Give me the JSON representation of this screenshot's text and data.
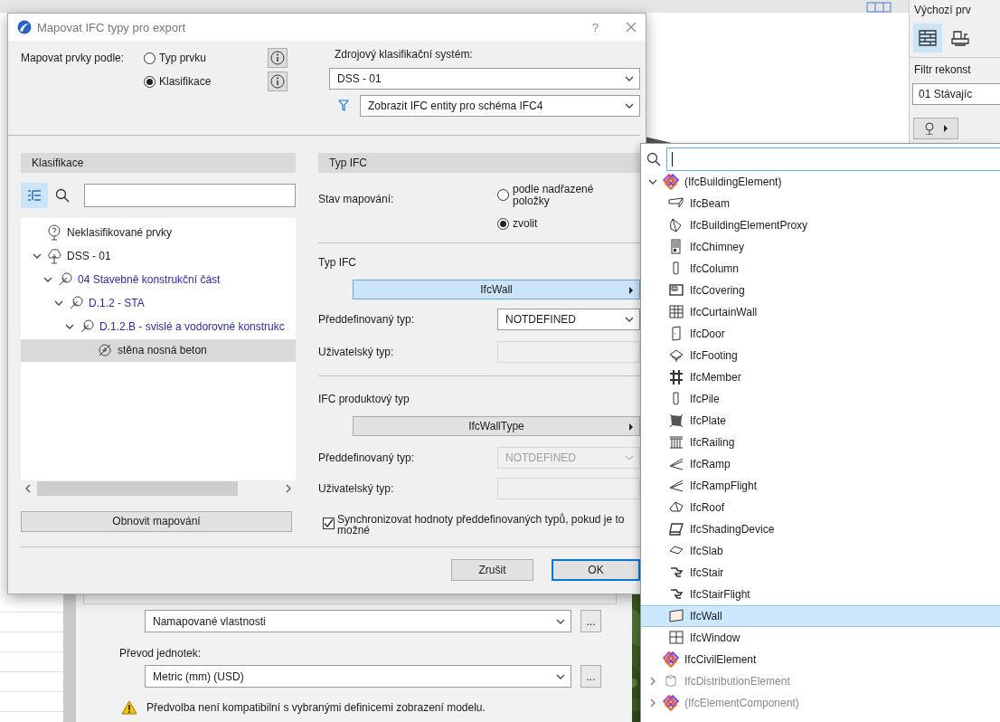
{
  "background": {
    "panel_title": "Výchozí prv",
    "filter_label": "Filtr rekonst",
    "filter_value": "01 Stávajíc",
    "back_dialog": {
      "property_value": "Namapované vlastnosti",
      "units_label": "Převod jednotek:",
      "units_value": "Metric (mm) (USD)",
      "more_button": "...",
      "warning": "Předvolba není kompatibilní s vybranými definicemi zobrazení modelu."
    }
  },
  "dialog": {
    "title": "Mapovat IFC typy pro export",
    "help": "?",
    "map_by_label": "Mapovat prvky podle:",
    "map_by_options": [
      {
        "label": "Typ prvku",
        "selected": false
      },
      {
        "label": "Klasifikace",
        "selected": true
      }
    ],
    "source_label": "Zdrojový klasifikační systém:",
    "source_value": "DSS - 01",
    "schema_filter": "Zobrazit IFC entity pro schéma IFC4",
    "classification": {
      "header": "Klasifikace",
      "tree": [
        {
          "label": "Neklasifikované prvky",
          "kind": "unclassified",
          "selected": false
        },
        {
          "label": "DSS - 01",
          "kind": "system",
          "selected": false,
          "expanded": true,
          "children": [
            {
              "label": "04 Stavebně konstrukční část",
              "kind": "group",
              "selected": false,
              "expanded": true,
              "children": [
                {
                  "label": "D.1.2 - STA",
                  "kind": "group",
                  "selected": false,
                  "expanded": true,
                  "children": [
                    {
                      "label": "D.1.2.B - svislé a vodorovné konstrukc",
                      "kind": "group",
                      "selected": false,
                      "expanded": true,
                      "children": [
                        {
                          "label": "stěna nosná beton",
                          "kind": "item",
                          "selected": true
                        }
                      ]
                    }
                  ]
                }
              ]
            }
          ]
        }
      ],
      "refresh_button": "Obnovit mapování"
    },
    "ifc_type": {
      "header": "Typ IFC",
      "status_label": "Stav mapování:",
      "status_options": [
        {
          "label": "podle nadřazené položky",
          "selected": false
        },
        {
          "label": "zvolit",
          "selected": true
        }
      ],
      "type_label": "Typ IFC",
      "type_value": "IfcWall",
      "predefined_label": "Předdefinovaný typ:",
      "predefined_value": "NOTDEFINED",
      "user_label": "Uživatelský typ:",
      "product_label": "IFC produktový typ",
      "product_value": "IfcWallType",
      "product_predefined_label": "Předdefinovaný typ:",
      "product_predefined_value": "NOTDEFINED",
      "product_predefined_disabled": true,
      "product_user_label": "Uživatelský typ:",
      "sync": {
        "label": "Synchronizovat hodnoty předdefinovaných typů, pokud je to možné",
        "checked": true
      }
    },
    "buttons": [
      {
        "label": "Zrušit",
        "default": false
      },
      {
        "label": "OK",
        "default": true
      }
    ]
  },
  "ifc_list": {
    "items": [
      {
        "label": "(IfcBuildingElement)",
        "kind": "group",
        "selected": false,
        "disabled": false,
        "expanded": true,
        "children": [
          {
            "label": "IfcBeam",
            "kind": "beam",
            "selected": false,
            "disabled": false
          },
          {
            "label": "IfcBuildingElementProxy",
            "kind": "proxy",
            "selected": false,
            "disabled": false
          },
          {
            "label": "IfcChimney",
            "kind": "chimney",
            "selected": false,
            "disabled": false
          },
          {
            "label": "IfcColumn",
            "kind": "column",
            "selected": false,
            "disabled": false
          },
          {
            "label": "IfcCovering",
            "kind": "covering",
            "selected": false,
            "disabled": false
          },
          {
            "label": "IfcCurtainWall",
            "kind": "curtainwall",
            "selected": false,
            "disabled": false
          },
          {
            "label": "IfcDoor",
            "kind": "door",
            "selected": false,
            "disabled": false
          },
          {
            "label": "IfcFooting",
            "kind": "footing",
            "selected": false,
            "disabled": false
          },
          {
            "label": "IfcMember",
            "kind": "member",
            "selected": false,
            "disabled": false
          },
          {
            "label": "IfcPile",
            "kind": "column",
            "selected": false,
            "disabled": false
          },
          {
            "label": "IfcPlate",
            "kind": "plate",
            "selected": false,
            "disabled": false
          },
          {
            "label": "IfcRailing",
            "kind": "railing",
            "selected": false,
            "disabled": false
          },
          {
            "label": "IfcRamp",
            "kind": "ramp",
            "selected": false,
            "disabled": false
          },
          {
            "label": "IfcRampFlight",
            "kind": "ramp",
            "selected": false,
            "disabled": false
          },
          {
            "label": "IfcRoof",
            "kind": "roof",
            "selected": false,
            "disabled": false
          },
          {
            "label": "IfcShadingDevice",
            "kind": "shading",
            "selected": false,
            "disabled": false
          },
          {
            "label": "IfcSlab",
            "kind": "slab",
            "selected": false,
            "disabled": false
          },
          {
            "label": "IfcStair",
            "kind": "stair",
            "selected": false,
            "disabled": false
          },
          {
            "label": "IfcStairFlight",
            "kind": "stair",
            "selected": false,
            "disabled": false
          },
          {
            "label": "IfcWall",
            "kind": "wall",
            "selected": true,
            "disabled": false
          },
          {
            "label": "IfcWindow",
            "kind": "window",
            "selected": false,
            "disabled": false
          }
        ]
      },
      {
        "label": "IfcCivilElement",
        "kind": "group",
        "selected": false,
        "disabled": false
      },
      {
        "label": "IfcDistributionElement",
        "kind": "distribution",
        "selected": false,
        "disabled": true,
        "expanded": false
      },
      {
        "label": "(IfcElementComponent)",
        "kind": "group",
        "selected": false,
        "disabled": true,
        "expanded": false
      }
    ]
  }
}
